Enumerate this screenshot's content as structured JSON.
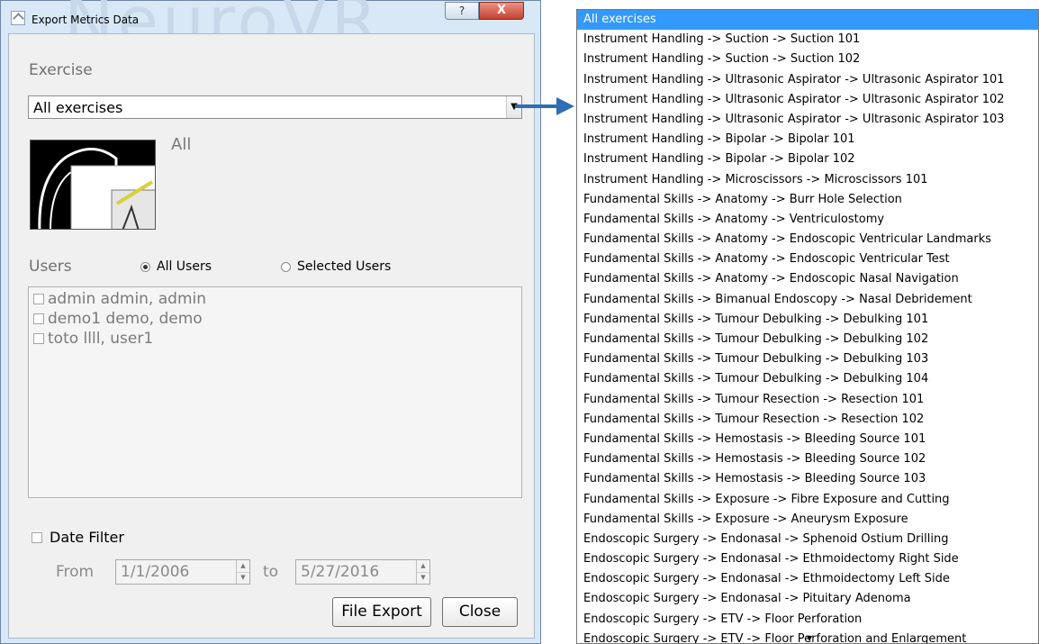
{
  "window": {
    "title": "Export Metrics Data",
    "help_label": "?",
    "close_label": "X",
    "watermark": "NeuroVR"
  },
  "exercise": {
    "label": "Exercise",
    "selected": "All exercises",
    "thumbnail_caption": "All"
  },
  "users": {
    "label": "Users",
    "option_all": "All Users",
    "option_selected": "Selected Users",
    "selected_option": "All Users",
    "list": [
      {
        "name": "admin admin, admin",
        "checked": false
      },
      {
        "name": "demo1 demo, demo",
        "checked": false
      },
      {
        "name": "toto llll, user1",
        "checked": false
      }
    ]
  },
  "date_filter": {
    "label": "Date Filter",
    "checked": false,
    "from_label": "From",
    "from_value": "1/1/2006",
    "to_label": "to",
    "to_value": "5/27/2016"
  },
  "buttons": {
    "export": "File Export",
    "close": "Close"
  },
  "dropdown": {
    "selected_index": 0,
    "items": [
      "All exercises",
      "Instrument Handling -> Suction -> Suction 101",
      "Instrument Handling -> Suction -> Suction 102",
      "Instrument Handling -> Ultrasonic Aspirator -> Ultrasonic Aspirator 101",
      "Instrument Handling -> Ultrasonic Aspirator -> Ultrasonic Aspirator 102",
      "Instrument Handling -> Ultrasonic Aspirator -> Ultrasonic Aspirator 103",
      "Instrument Handling -> Bipolar -> Bipolar 101",
      "Instrument Handling -> Bipolar -> Bipolar 102",
      "Instrument Handling -> Microscissors -> Microscissors 101",
      "Fundamental Skills -> Anatomy -> Burr Hole Selection",
      "Fundamental Skills -> Anatomy -> Ventriculostomy",
      "Fundamental Skills -> Anatomy -> Endoscopic Ventricular Landmarks",
      "Fundamental Skills -> Anatomy -> Endoscopic Ventricular Test",
      "Fundamental Skills -> Anatomy -> Endoscopic Nasal Navigation",
      "Fundamental Skills -> Bimanual Endoscopy -> Nasal Debridement",
      "Fundamental Skills -> Tumour Debulking -> Debulking 101",
      "Fundamental Skills -> Tumour Debulking -> Debulking 102",
      "Fundamental Skills -> Tumour Debulking -> Debulking 103",
      "Fundamental Skills -> Tumour Debulking -> Debulking 104",
      "Fundamental Skills -> Tumour Resection -> Resection 101",
      "Fundamental Skills -> Tumour Resection -> Resection 102",
      "Fundamental Skills -> Hemostasis -> Bleeding Source 101",
      "Fundamental Skills -> Hemostasis -> Bleeding Source 102",
      "Fundamental Skills -> Hemostasis -> Bleeding Source 103",
      "Fundamental Skills -> Exposure -> Fibre Exposure and Cutting",
      "Fundamental Skills -> Exposure -> Aneurysm Exposure",
      "Endoscopic Surgery -> Endonasal -> Sphenoid Ostium Drilling",
      "Endoscopic Surgery -> Endonasal -> Ethmoidectomy Right Side",
      "Endoscopic Surgery -> Endonasal -> Ethmoidectomy Left Side",
      "Endoscopic Surgery -> Endonasal -> Pituitary Adenoma",
      "Endoscopic Surgery -> ETV -> Floor Perforation",
      "Endoscopic Surgery -> ETV -> Floor Perforation and Enlargement"
    ]
  },
  "colors": {
    "selection": "#3399ff",
    "arrow": "#2f6db5",
    "window_frame": "#d9e8f7",
    "close_button": "#c64131"
  },
  "icons": [
    "app-icon",
    "help-icon",
    "close-icon",
    "chevron-down-icon",
    "spin-up-icon",
    "spin-down-icon",
    "arrow-right-icon"
  ]
}
